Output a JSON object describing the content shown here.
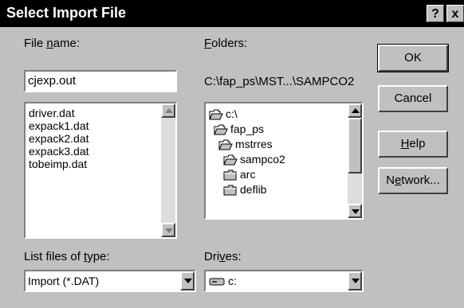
{
  "window": {
    "title": "Select Import File",
    "help_button": "?",
    "close_button": "x"
  },
  "file_name": {
    "label_pre": "File ",
    "label_accel": "n",
    "label_post": "ame:",
    "value": "cjexp.out"
  },
  "files": [
    "driver.dat",
    "expack1.dat",
    "expack2.dat",
    "expack3.dat",
    "tobeimp.dat"
  ],
  "folders": {
    "label_accel": "F",
    "label_post": "olders:",
    "current_path": "C:\\fap_ps\\MST...\\SAMPCO2",
    "items": [
      {
        "name": "c:\\",
        "icon": "open-folder-icon"
      },
      {
        "name": "fap_ps",
        "icon": "open-folder-icon"
      },
      {
        "name": "mstrres",
        "icon": "open-folder-icon"
      },
      {
        "name": "sampco2",
        "icon": "open-folder-icon"
      },
      {
        "name": "arc",
        "icon": "closed-folder-icon"
      },
      {
        "name": "deflib",
        "icon": "closed-folder-icon"
      }
    ]
  },
  "file_type": {
    "label_pre": "List files of ",
    "label_accel": "t",
    "label_post": "ype:",
    "value": "Import (*.DAT)"
  },
  "drives": {
    "label_pre": "Dri",
    "label_accel": "v",
    "label_post": "es:",
    "value": "c:",
    "icon": "drive-icon"
  },
  "buttons": {
    "ok": "OK",
    "cancel": "Cancel",
    "help_accel": "H",
    "help_post": "elp",
    "network_pre": "N",
    "network_accel": "e",
    "network_post": "twork..."
  }
}
